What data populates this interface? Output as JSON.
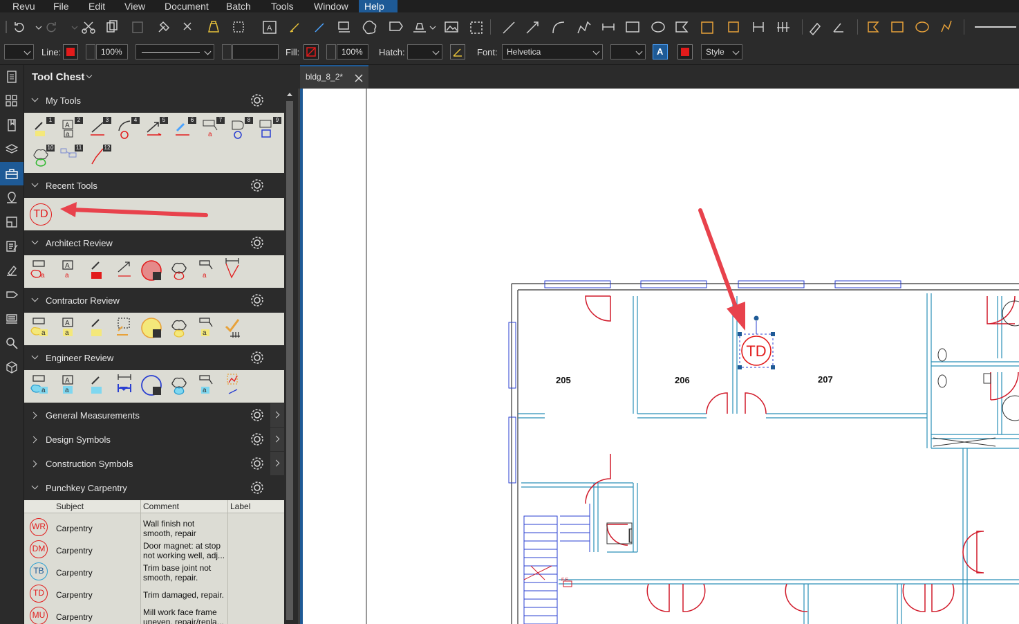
{
  "menu": [
    "Revu",
    "File",
    "Edit",
    "View",
    "Document",
    "Batch",
    "Tools",
    "Window",
    "Help"
  ],
  "menu_active": "Help",
  "props": {
    "line_label": "Line:",
    "line_opacity": "100%",
    "fill_label": "Fill:",
    "fill_opacity": "100%",
    "hatch_label": "Hatch:",
    "font_label": "Font:",
    "font_value": "Helvetica",
    "style_value": "Style",
    "accent_red": "#e21b1b",
    "accent_blue": "#1e5a96"
  },
  "panel": {
    "title": "Tool Chest",
    "sections": {
      "my_tools": "My Tools",
      "recent_tools": "Recent Tools",
      "architect_review": "Architect Review",
      "contractor_review": "Contractor Review",
      "engineer_review": "Engineer Review",
      "general_measurements": "General Measurements",
      "design_symbols": "Design Symbols",
      "construction_symbols": "Construction Symbols",
      "punchkey_carpentry": "Punchkey Carpentry"
    },
    "my_tools_badges": [
      "1",
      "2",
      "3",
      "4",
      "5",
      "6",
      "7",
      "8",
      "9",
      "10",
      "11",
      "12"
    ],
    "recent_tool_label": "TD",
    "table_headers": {
      "subject": "Subject",
      "comment": "Comment",
      "label": "Label"
    },
    "punch_rows": [
      {
        "key": "WR",
        "subject": "Carpentry",
        "comment1": "Wall finish not",
        "comment2": "smooth, repair"
      },
      {
        "key": "DM",
        "subject": "Carpentry",
        "comment1": "Door magnet: at stop",
        "comment2": "not working well, adj..."
      },
      {
        "key": "TB",
        "subject": "Carpentry",
        "comment1": "Trim base joint not",
        "comment2": "smooth, repair."
      },
      {
        "key": "TD",
        "subject": "Carpentry",
        "comment1": "Trim damaged, repair.",
        "comment2": ""
      },
      {
        "key": "MU",
        "subject": "Carpentry",
        "comment1": "Mill work face frame",
        "comment2": "uneven, repair/repla..."
      }
    ]
  },
  "document": {
    "tab_label": "bldg_8_2*",
    "rooms": [
      "205",
      "206",
      "207"
    ],
    "markup_label": "TD",
    "small_text": "F.E."
  }
}
